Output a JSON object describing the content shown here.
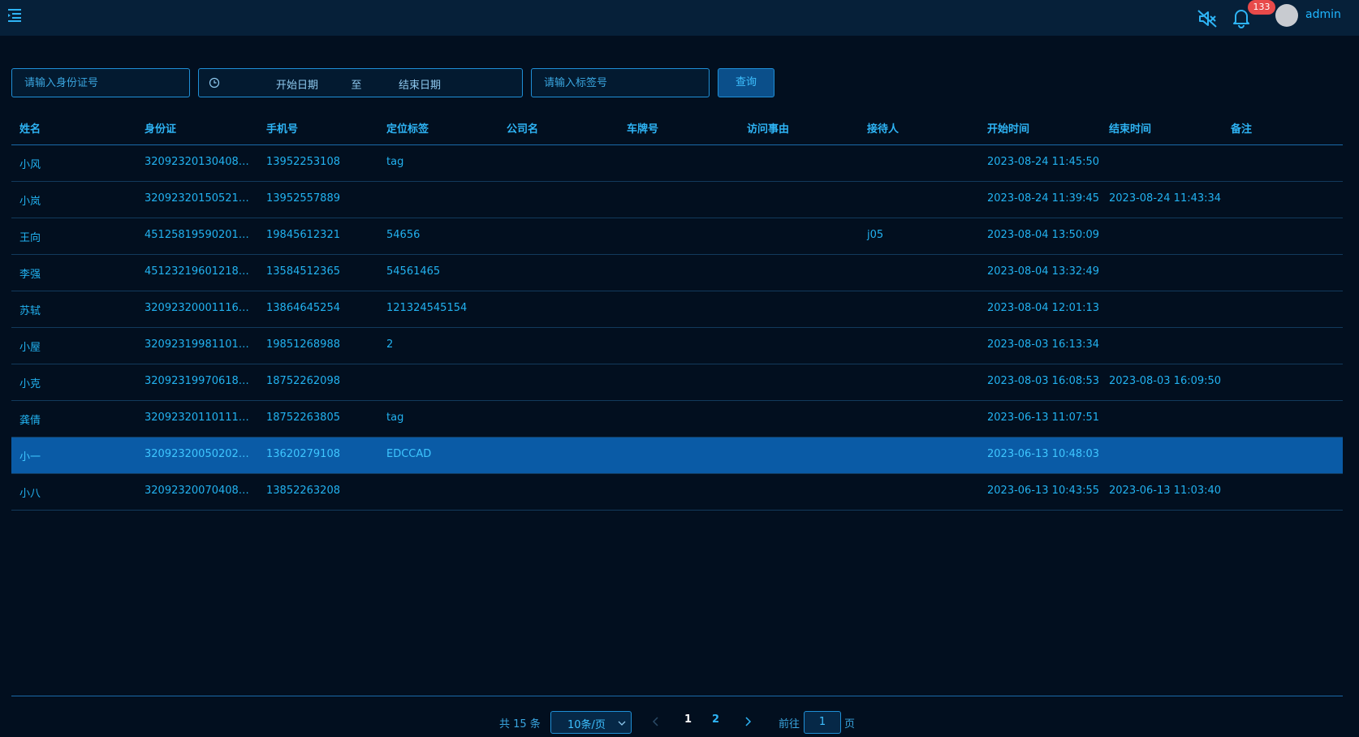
{
  "header": {
    "username": "admin",
    "notification_count": "133",
    "icons": [
      "menu-icon",
      "mute-icon",
      "bell-icon",
      "avatar"
    ]
  },
  "filters": {
    "id_placeholder": "请输入身份证号",
    "start_date_placeholder": "开始日期",
    "range_separator": "至",
    "end_date_placeholder": "结束日期",
    "tag_placeholder": "请输入标签号",
    "query_label": "查询"
  },
  "table": {
    "columns": [
      "姓名",
      "身份证",
      "手机号",
      "定位标签",
      "公司名",
      "车牌号",
      "访问事由",
      "接待人",
      "开始时间",
      "结束时间",
      "备注"
    ],
    "rows": [
      [
        "小风",
        "32092320130408…",
        "13952253108",
        "tag",
        "",
        "",
        "",
        "",
        "2023-08-24 11:45:50",
        "",
        ""
      ],
      [
        "小岚",
        "32092320150521…",
        "13952557889",
        "",
        "",
        "",
        "",
        "",
        "2023-08-24 11:39:45",
        "2023-08-24 11:43:34",
        ""
      ],
      [
        "王向",
        "45125819590201…",
        "19845612321",
        "54656",
        "",
        "",
        "",
        "j05",
        "2023-08-04 13:50:09",
        "",
        ""
      ],
      [
        "李强",
        "45123219601218…",
        "13584512365",
        "54561465",
        "",
        "",
        "",
        "",
        "2023-08-04 13:32:49",
        "",
        ""
      ],
      [
        "苏轼",
        "32092320001116…",
        "13864645254",
        "121324545154",
        "",
        "",
        "",
        "",
        "2023-08-04 12:01:13",
        "",
        ""
      ],
      [
        "小屋",
        "32092319981101…",
        "19851268988",
        "2",
        "",
        "",
        "",
        "",
        "2023-08-03 16:13:34",
        "",
        ""
      ],
      [
        "小克",
        "32092319970618…",
        "18752262098",
        "",
        "",
        "",
        "",
        "",
        "2023-08-03 16:08:53",
        "2023-08-03 16:09:50",
        ""
      ],
      [
        "龚倩",
        "32092320110111…",
        "18752263805",
        "tag",
        "",
        "",
        "",
        "",
        "2023-06-13 11:07:51",
        "",
        ""
      ],
      [
        "小一",
        "32092320050202…",
        "13620279108",
        "EDCCAD",
        "",
        "",
        "",
        "",
        "2023-06-13 10:48:03",
        "",
        ""
      ],
      [
        "小八",
        "32092320070408…",
        "13852263208",
        "",
        "",
        "",
        "",
        "",
        "2023-06-13 10:43:55",
        "2023-06-13 11:03:40",
        ""
      ]
    ],
    "selected_row": 8
  },
  "pagination": {
    "total": "共 15 条",
    "page_size": "10条/页",
    "pages": [
      "1",
      "2"
    ],
    "current_page": "1",
    "goto_label": "前往",
    "goto_value": "1",
    "page_suffix": "页"
  },
  "colors": {
    "background": "#020f1f",
    "header": "#062039",
    "accent": "#1fb6ff",
    "selected_row": "#0a5ba6",
    "badge": "#e84a4a"
  }
}
